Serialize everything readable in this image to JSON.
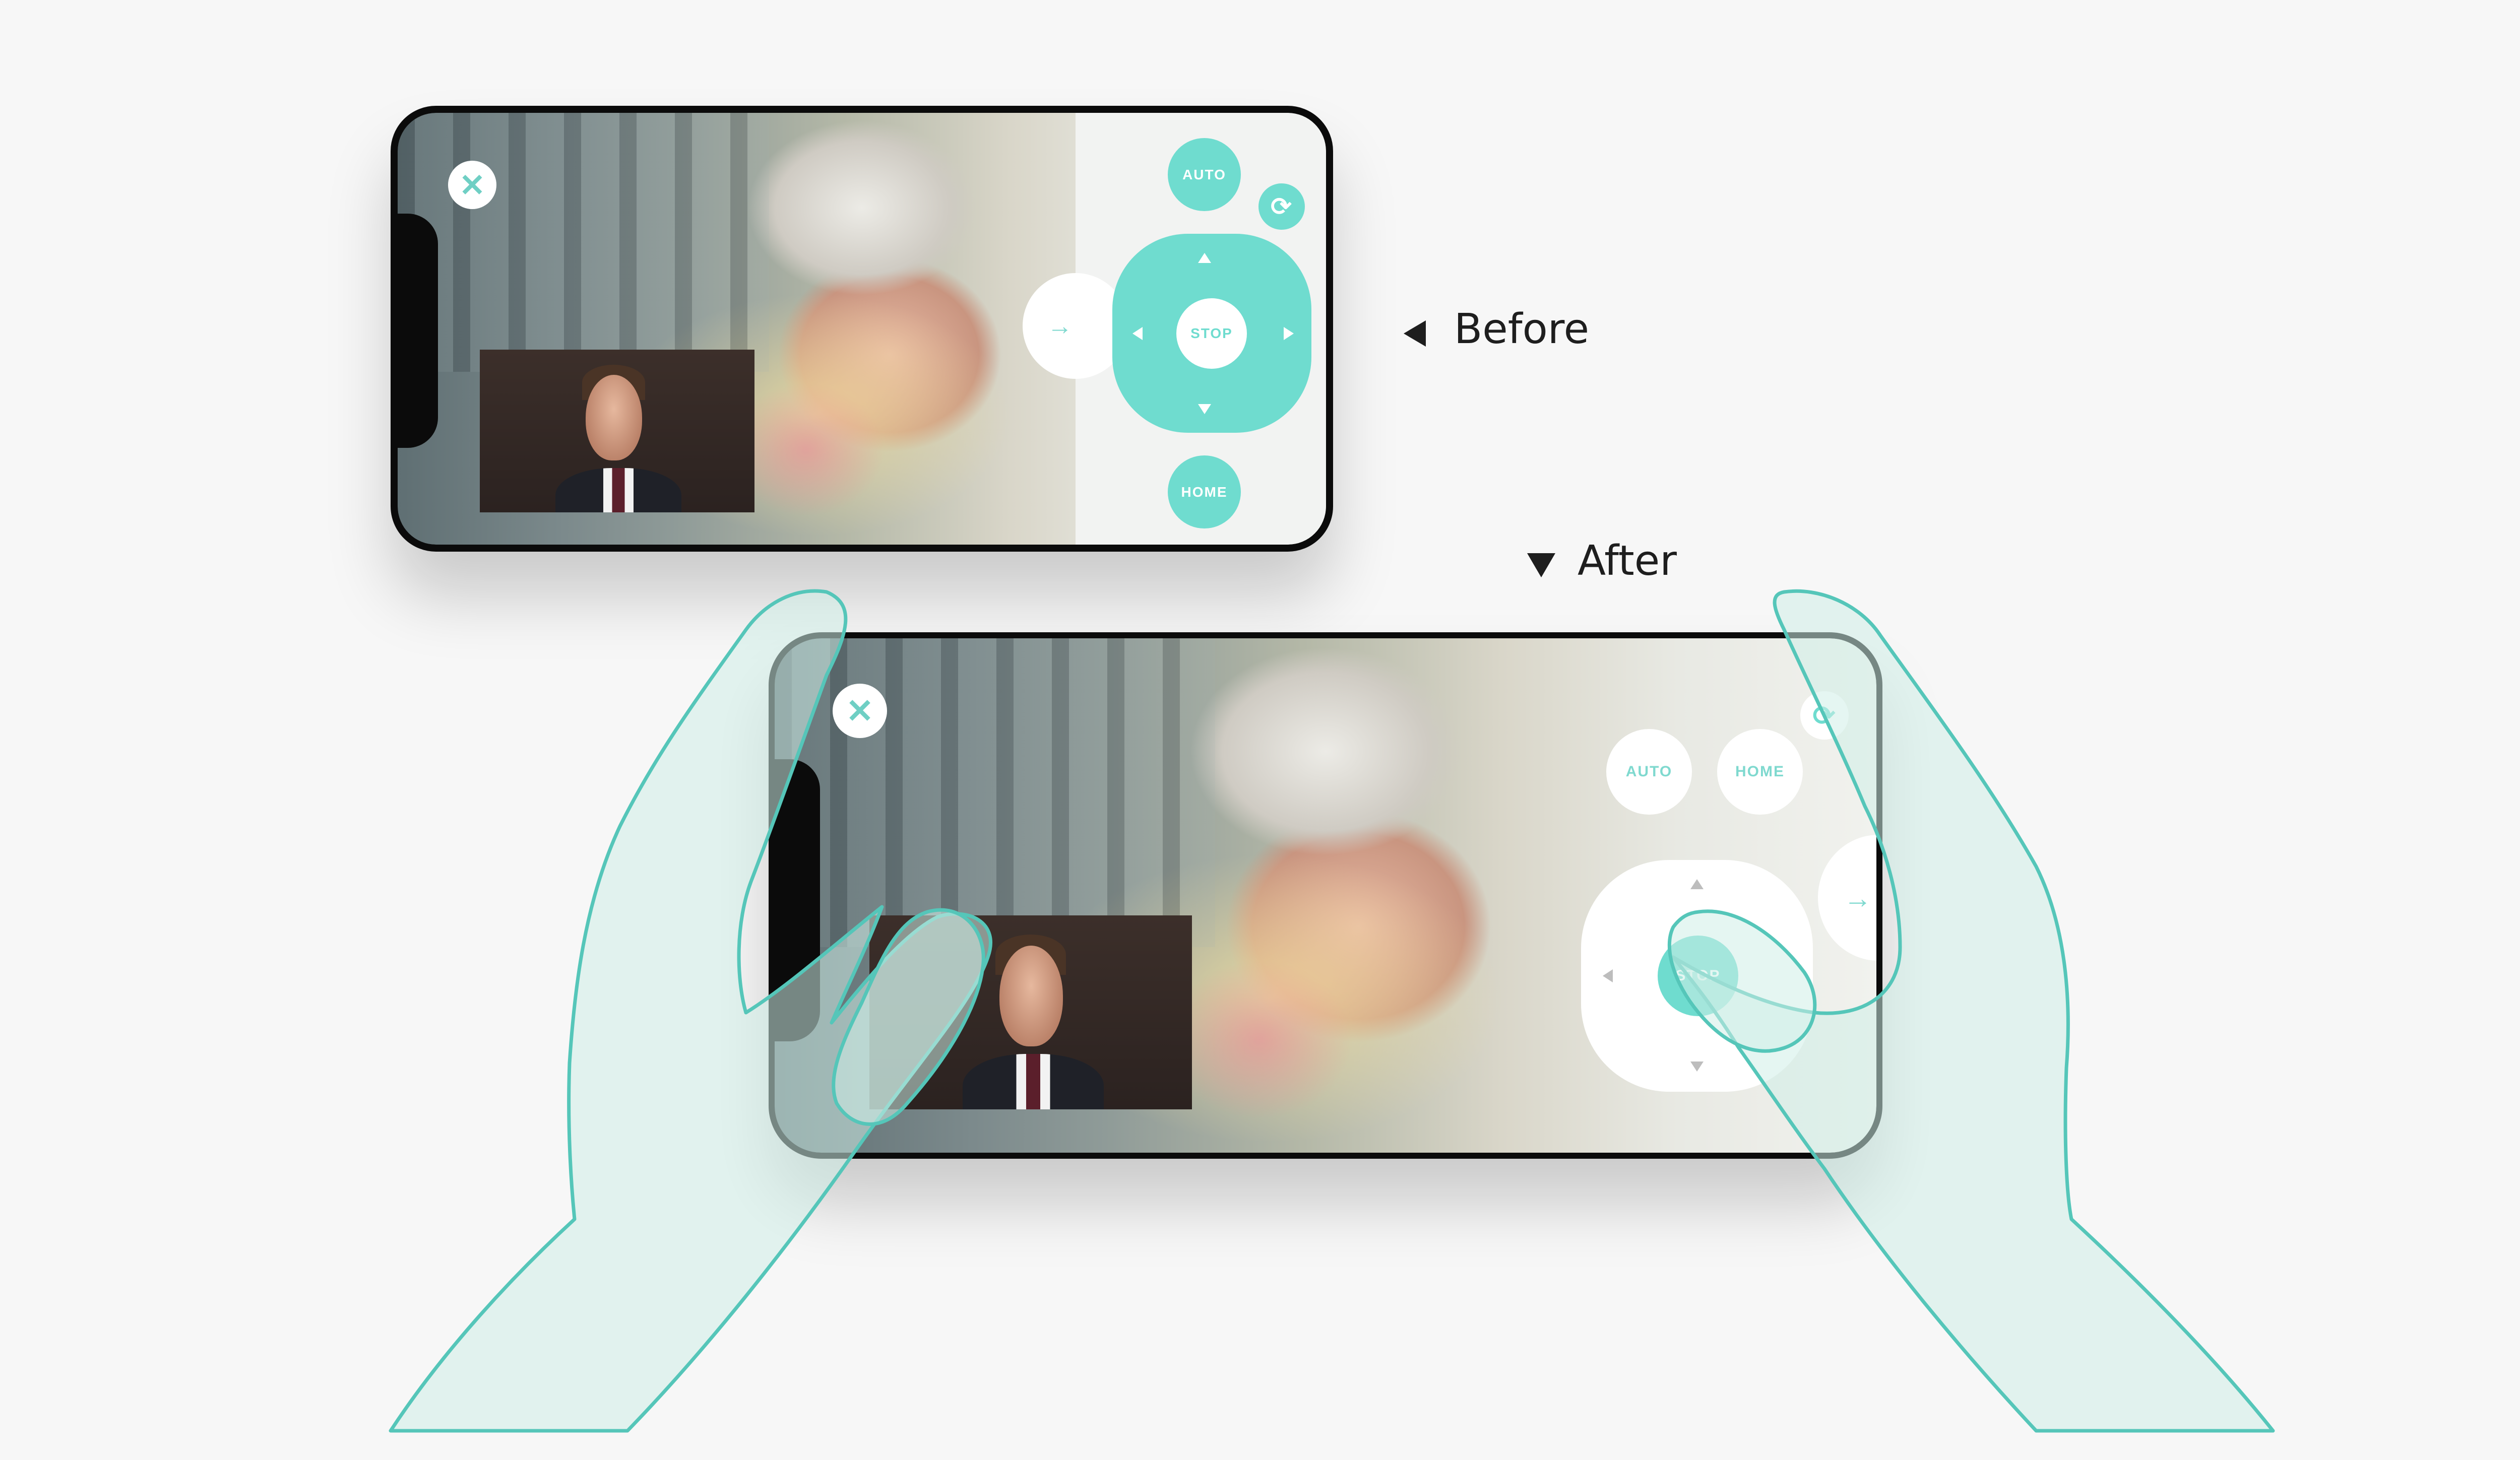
{
  "annotations": {
    "before_label": "Before",
    "after_label": "After"
  },
  "before": {
    "auto_label": "AUTO",
    "home_label": "HOME",
    "stop_label": "STOP",
    "icons": [
      "close-icon",
      "rotate-icon",
      "arrow-up-icon",
      "arrow-down-icon",
      "arrow-left-icon",
      "arrow-right-icon",
      "side-arrow-icon"
    ]
  },
  "after": {
    "auto_label": "AUTO",
    "home_label": "HOME",
    "stop_label": "STOP",
    "icons": [
      "close-icon",
      "rotate-icon",
      "arrow-up-icon",
      "arrow-down-icon",
      "arrow-left-icon",
      "side-arrow-icon"
    ]
  },
  "colors": {
    "accent": "#6fdccf",
    "hand_fill": "#d6f2ec",
    "hand_stroke": "#5cc9bd",
    "frame": "#0b0b0b",
    "background": "#f7f7f7"
  }
}
